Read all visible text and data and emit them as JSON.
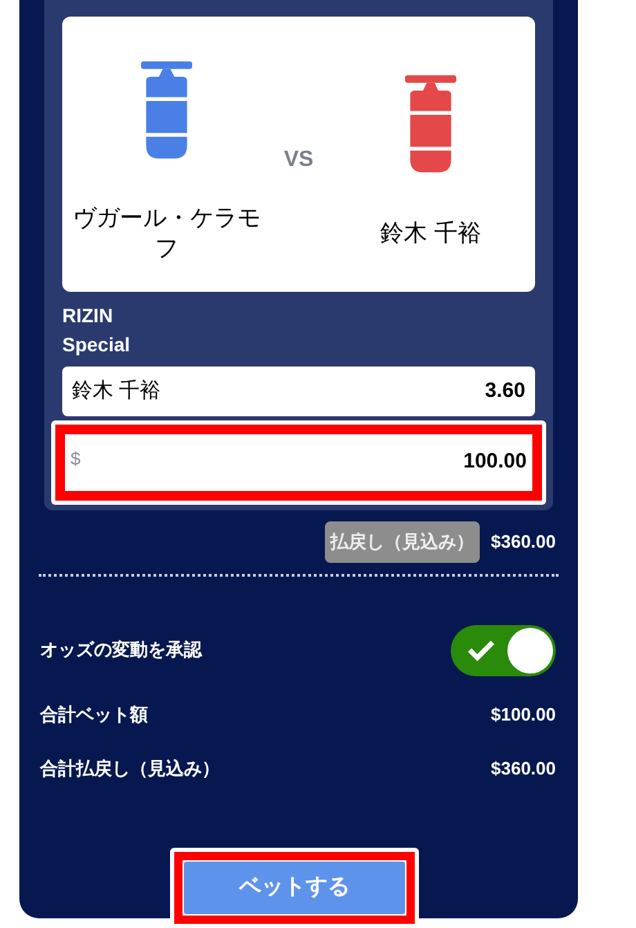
{
  "matchup": {
    "fighters": [
      {
        "name": "ヴガール・ケラモフ",
        "color": "#4a7fe6"
      },
      {
        "name": "鈴木 千裕",
        "color": "#e44848"
      }
    ],
    "vs": "VS"
  },
  "market": "RIZIN Special",
  "selection": {
    "name": "鈴木 千裕",
    "odds": "3.60"
  },
  "stake": {
    "prefix": "$",
    "value": "100.00"
  },
  "payout": {
    "label": "払戻し（見込み）",
    "value": "$360.00"
  },
  "accept_odds": {
    "label": "オッズの変動を承認",
    "on": true
  },
  "totals": [
    {
      "label": "合計ベット額",
      "value": "$100.00"
    },
    {
      "label": "合計払戻し（見込み）",
      "value": "$360.00"
    }
  ],
  "bet_button": "ベットする"
}
